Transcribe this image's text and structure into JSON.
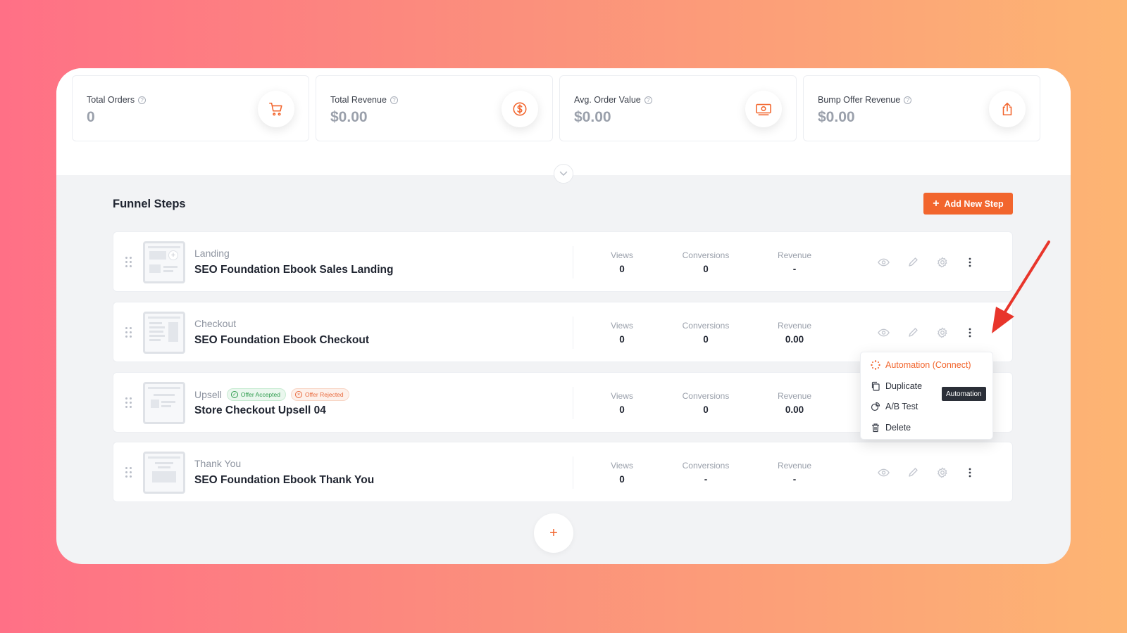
{
  "stats": [
    {
      "label": "Total Orders",
      "value": "0",
      "icon": "cart-icon"
    },
    {
      "label": "Total Revenue",
      "value": "$0.00",
      "icon": "dollar-icon"
    },
    {
      "label": "Avg. Order Value",
      "value": "$0.00",
      "icon": "cash-icon"
    },
    {
      "label": "Bump Offer Revenue",
      "value": "$0.00",
      "icon": "share-icon"
    }
  ],
  "section": {
    "title": "Funnel Steps",
    "add_button": "Add New Step"
  },
  "metric_labels": {
    "views": "Views",
    "conversions": "Conversions",
    "revenue": "Revenue"
  },
  "steps": [
    {
      "type": "Landing",
      "name": "SEO Foundation Ebook Sales Landing",
      "views": "0",
      "conversions": "0",
      "revenue": "-"
    },
    {
      "type": "Checkout",
      "name": "SEO Foundation Ebook Checkout",
      "views": "0",
      "conversions": "0",
      "revenue": "0.00"
    },
    {
      "type": "Upsell",
      "name": "Store Checkout Upsell 04",
      "views": "0",
      "conversions": "0",
      "revenue": "0.00",
      "badges": {
        "accepted": "Offer Accepted",
        "rejected": "Offer Rejected"
      }
    },
    {
      "type": "Thank You",
      "name": "SEO Foundation Ebook Thank You",
      "views": "0",
      "conversions": "-",
      "revenue": "-"
    }
  ],
  "dropdown": {
    "items": [
      {
        "label": "Automation (Connect)",
        "icon": "automation-icon"
      },
      {
        "label": "Duplicate",
        "icon": "duplicate-icon"
      },
      {
        "label": "A/B Test",
        "icon": "ab-test-icon"
      },
      {
        "label": "Delete",
        "icon": "trash-icon"
      }
    ],
    "tooltip": "Automation"
  },
  "colors": {
    "accent": "#f2652d",
    "annotation_arrow": "#e8352b"
  }
}
